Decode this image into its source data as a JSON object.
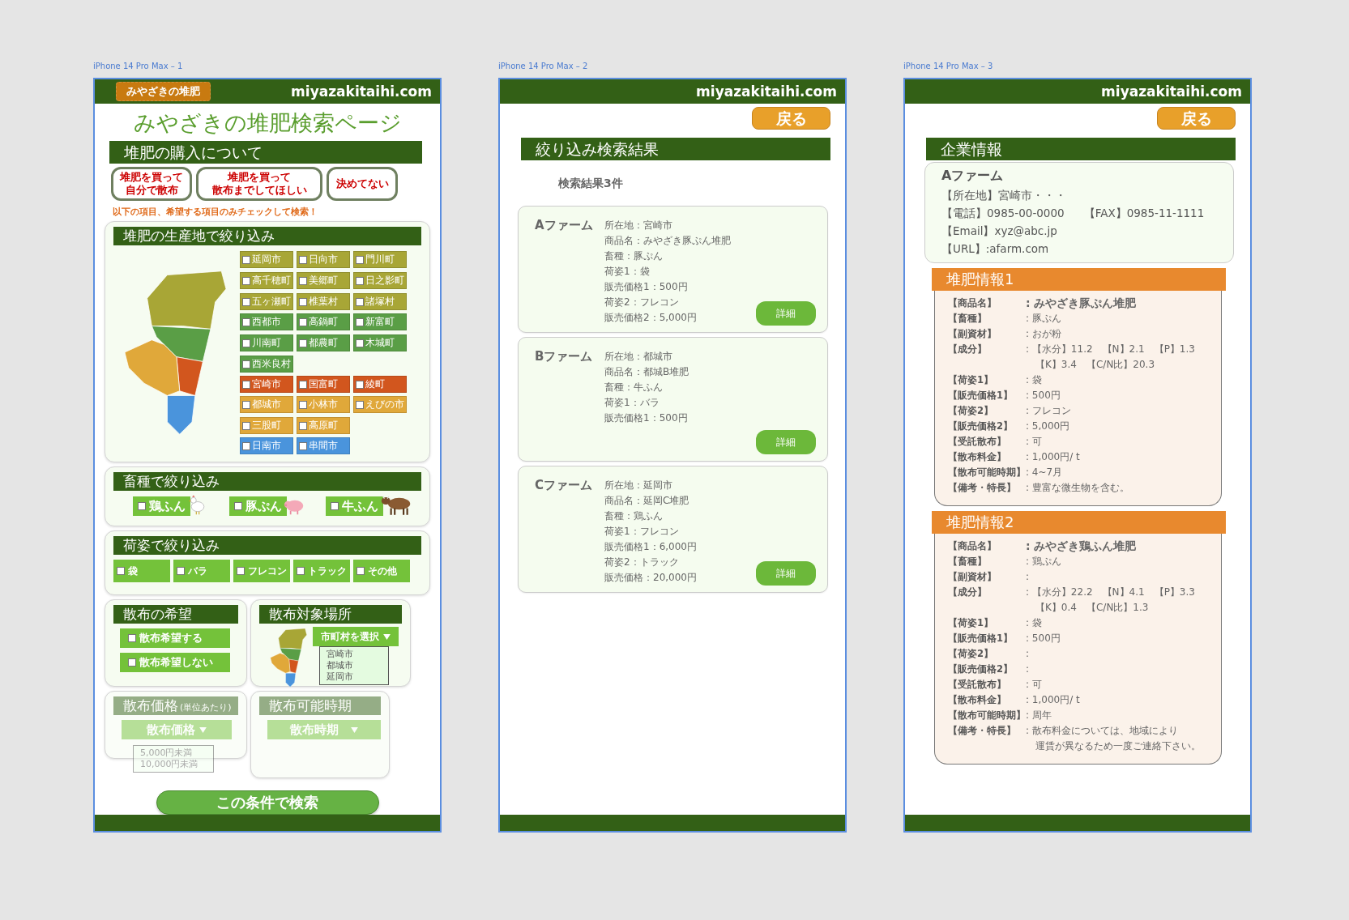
{
  "screens": {
    "search": {
      "label": "iPhone 14 Pro Max – 1",
      "logo": "みやざきの堆肥",
      "site": "miyazakitaihi.com",
      "title": "みやざきの堆肥検索ページ",
      "purchase": {
        "heading": "堆肥の購入について",
        "options": [
          {
            "lines": [
              "堆肥を買って",
              "自分で散布"
            ]
          },
          {
            "lines": [
              "堆肥を買って",
              "散布までしてほしい"
            ]
          },
          {
            "lines": [
              "決めてない"
            ]
          }
        ]
      },
      "note": "以下の項目、希望する項目のみチェックして検索！",
      "origin": {
        "heading": "堆肥の生産地で絞り込み",
        "areas": [
          {
            "color": "#a8a636",
            "towns": [
              {
                "name": "延岡市",
                "checked": false
              },
              {
                "name": "日向市",
                "checked": false
              },
              {
                "name": "門川町",
                "checked": false
              },
              {
                "name": "高千穂町",
                "checked": false
              },
              {
                "name": "美郷町",
                "checked": false
              },
              {
                "name": "日之影町",
                "checked": false
              },
              {
                "name": "五ヶ瀬町",
                "checked": false
              },
              {
                "name": "椎葉村",
                "checked": false
              },
              {
                "name": "諸塚村",
                "checked": false
              }
            ]
          },
          {
            "color": "#5a9e46",
            "towns": [
              {
                "name": "西都市",
                "checked": false
              },
              {
                "name": "高鍋町",
                "checked": false
              },
              {
                "name": "新富町",
                "checked": false
              },
              {
                "name": "川南町",
                "checked": false
              },
              {
                "name": "都農町",
                "checked": false
              },
              {
                "name": "木城町",
                "checked": false
              },
              {
                "name": "西米良村",
                "checked": false
              }
            ]
          },
          {
            "color": "#d2561e",
            "towns": [
              {
                "name": "宮崎市",
                "checked": false
              },
              {
                "name": "国富町",
                "checked": false
              },
              {
                "name": "綾町",
                "checked": false
              }
            ]
          },
          {
            "color": "#e0a83a",
            "towns": [
              {
                "name": "都城市",
                "checked": false
              },
              {
                "name": "小林市",
                "checked": false
              },
              {
                "name": "えびの市",
                "checked": false
              },
              {
                "name": "三股町",
                "checked": false
              },
              {
                "name": "高原町",
                "checked": false
              }
            ]
          },
          {
            "color": "#4a94dc",
            "towns": [
              {
                "name": "日南市",
                "checked": false
              },
              {
                "name": "串間市",
                "checked": false
              }
            ]
          }
        ]
      },
      "livestock": {
        "heading": "畜種で絞り込み",
        "items": [
          {
            "label": "鶏ふん",
            "kind": "chicken",
            "checked": false
          },
          {
            "label": "豚ぷん",
            "kind": "pig",
            "checked": false
          },
          {
            "label": "牛ふん",
            "kind": "cow",
            "checked": false
          }
        ]
      },
      "packaging": {
        "heading": "荷姿で絞り込み",
        "items": [
          {
            "label": "袋",
            "checked": false
          },
          {
            "label": "バラ",
            "checked": false
          },
          {
            "label": "フレコン",
            "checked": false
          },
          {
            "label": "トラック",
            "checked": false
          },
          {
            "label": "その他",
            "checked": false
          }
        ]
      },
      "spread_wish": {
        "heading": "散布の希望",
        "items": [
          {
            "label": "散布希望する",
            "checked": false
          },
          {
            "label": "散布希望しない",
            "checked": false
          }
        ]
      },
      "spread_place": {
        "heading": "散布対象場所",
        "select": "市町村を選択",
        "options": [
          "宮崎市",
          "都城市",
          "延岡市"
        ]
      },
      "spread_price": {
        "heading": "散布価格",
        "subheading": "(単位あたり)",
        "select": "散布価格",
        "options": [
          "5,000円未満",
          "10,000円未満"
        ],
        "disabled": true
      },
      "spread_period": {
        "heading": "散布可能時期",
        "select": "散布時期",
        "disabled": true
      },
      "search_button": "この条件で検索"
    },
    "results": {
      "label": "iPhone 14 Pro Max – 2",
      "site": "miyazakitaihi.com",
      "back": "戻る",
      "heading": "絞り込み検索結果",
      "count": "検索結果3件",
      "items": [
        {
          "name": "Aファーム",
          "lines": [
            "所在地：宮崎市",
            "商品名：みやざき豚ぷん堆肥",
            "畜種：豚ぷん",
            "荷姿1：袋",
            "販売価格1：500円",
            "荷姿2：フレコン",
            "販売価格2：5,000円"
          ],
          "button": "詳細"
        },
        {
          "name": "Bファーム",
          "lines": [
            "所在地：都城市",
            "商品名：都城B堆肥",
            "畜種：牛ふん",
            "荷姿1：バラ",
            "販売価格1：500円"
          ],
          "button": "詳細"
        },
        {
          "name": "Cファーム",
          "lines": [
            "所在地：延岡市",
            "商品名：延岡C堆肥",
            "畜種：鶏ふん",
            "荷姿1：フレコン",
            "販売価格1：6,000円",
            "荷姿2：トラック",
            "販売価格：20,000円"
          ],
          "button": "詳細"
        }
      ]
    },
    "detail": {
      "label": "iPhone 14 Pro Max – 3",
      "site": "miyazakitaihi.com",
      "back": "戻る",
      "heading": "企業情報",
      "company": {
        "name": "Aファーム",
        "rows": [
          [
            "【所在地】宮崎市・・・"
          ],
          [
            "【電話】0985-00-0000",
            "【FAX】0985-11-1111"
          ],
          [
            "【Email】xyz@abc.jp"
          ],
          [
            "【URL】:afarm.com"
          ]
        ]
      },
      "products": [
        {
          "heading": "堆肥情報1",
          "rows": [
            {
              "label": "【商品名】",
              "value": [
                ": みやざき豚ぷん堆肥"
              ],
              "kind": "name"
            },
            {
              "label": "【畜種】",
              "value": [
                ": 豚ぷん"
              ]
            },
            {
              "label": "【副資材】",
              "value": [
                ": おが粉"
              ]
            },
            {
              "label": "【成分】",
              "value": [
                ":  【水分】11.2　【N】2.1　【P】1.3",
                "【K】3.4　【C/N比】20.3"
              ]
            },
            {
              "label": "【荷姿1】",
              "value": [
                ": 袋"
              ]
            },
            {
              "label": "【販売価格1】",
              "value": [
                ": 500円"
              ]
            },
            {
              "label": "【荷姿2】",
              "value": [
                ": フレコン"
              ]
            },
            {
              "label": "【販売価格2】",
              "value": [
                ": 5,000円"
              ]
            },
            {
              "label": "【受託散布】",
              "value": [
                ": 可"
              ]
            },
            {
              "label": "【散布料金】",
              "value": [
                ": 1,000円/ t"
              ]
            },
            {
              "label": "【散布可能時期】",
              "value": [
                ": 4~7月"
              ]
            },
            {
              "label": "【備考・特長】",
              "value": [
                ": 豊富な微生物を含む。"
              ]
            }
          ]
        },
        {
          "heading": "堆肥情報2",
          "rows": [
            {
              "label": "【商品名】",
              "value": [
                ": みやざき鶏ふん堆肥"
              ],
              "kind": "name"
            },
            {
              "label": "【畜種】",
              "value": [
                ": 鶏ぷん"
              ]
            },
            {
              "label": "【副資材】",
              "value": [
                ":"
              ]
            },
            {
              "label": "【成分】",
              "value": [
                ":  【水分】22.2　【N】4.1　【P】3.3",
                "【K】0.4　【C/N比】1.3"
              ]
            },
            {
              "label": "【荷姿1】",
              "value": [
                ": 袋"
              ]
            },
            {
              "label": "【販売価格1】",
              "value": [
                ": 500円"
              ]
            },
            {
              "label": "【荷姿2】",
              "value": [
                ":"
              ]
            },
            {
              "label": "【販売価格2】",
              "value": [
                ":"
              ]
            },
            {
              "label": "【受託散布】",
              "value": [
                ": 可"
              ]
            },
            {
              "label": "【散布料金】",
              "value": [
                ": 1,000円/ t"
              ]
            },
            {
              "label": "【散布可能時期】",
              "value": [
                ": 周年"
              ]
            },
            {
              "label": "【備考・特長】",
              "value": [
                ": 散布料金については、地域により",
                "運賃が異なるため一度ご連絡下さい。"
              ]
            }
          ]
        }
      ]
    }
  }
}
